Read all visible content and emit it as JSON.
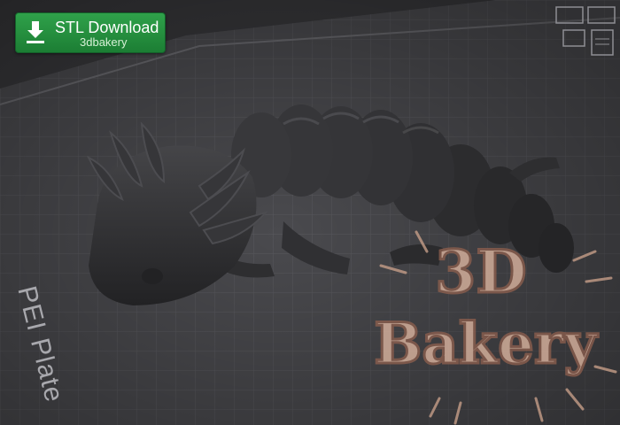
{
  "download": {
    "label": "STL Download",
    "sub": "3dbakery"
  },
  "plate": {
    "label": "PEI Plate"
  },
  "watermark": {
    "line1": "3D",
    "line2": "Bakery"
  },
  "model": {
    "subject": "articulated-axolotl",
    "color": "#2e2e30"
  },
  "colors": {
    "plate": "#4c4c50",
    "grid": "#5e5e63",
    "button": "#1f8a3c",
    "watermark": "#c9a08a"
  },
  "icons": [
    "download-icon",
    "top-toolbar-icons"
  ]
}
